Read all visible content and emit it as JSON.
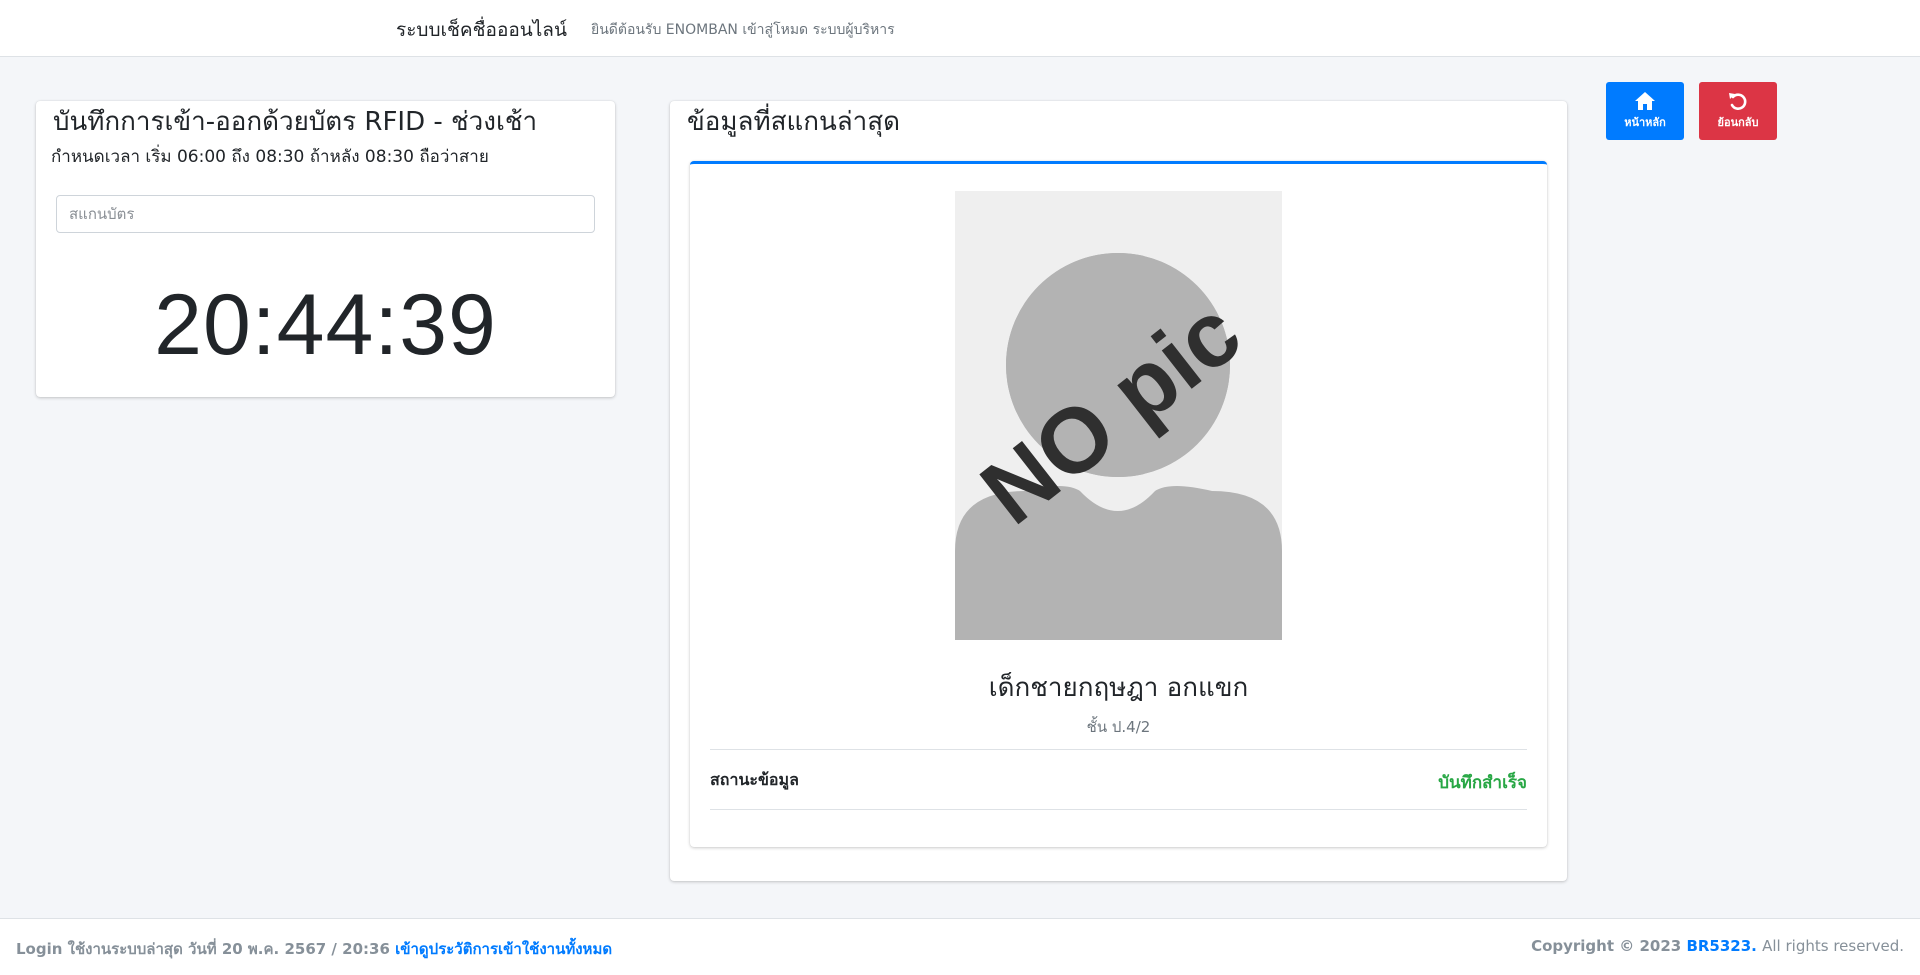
{
  "navbar": {
    "brand": "ระบบเช็คชื่อออนไลน์",
    "welcome": "ยินดีต้อนรับ ENOMBAN เข้าสู่โหมด ระบบผู้บริหาร"
  },
  "scan_panel": {
    "title": "บันทึกการเข้า-ออกด้วยบัตร RFID - ช่วงเช้า",
    "subtitle": "กำหนดเวลา เริ่ม 06:00 ถึง 08:30 ถ้าหลัง 08:30 ถือว่าสาย",
    "input_placeholder": "สแกนบัตร",
    "input_value": "",
    "clock": "20:44:39"
  },
  "latest_scan": {
    "title": "ข้อมูลที่สแกนล่าสุด",
    "photo_alt_text": "NO pic",
    "student_name": "เด็กชายกฤษฎา อกแขก",
    "student_class": "ชั้น ป.4/2",
    "status_label": "สถานะข้อมูล",
    "status_value": "บันทึกสำเร็จ",
    "status_color": "#28a745"
  },
  "actions": {
    "home_label": "หน้าหลัก",
    "home_icon": "home-icon",
    "home_color": "#007bff",
    "back_label": "ย้อนกลับ",
    "back_icon": "undo-icon",
    "back_color": "#dc3545"
  },
  "footer": {
    "login_prefix": "Login ใช้งานระบบล่าสุด วันที่ 20 พ.ค. 2567 / 20:36",
    "history_link": "เข้าดูประวัติการเข้าใช้งานทั้งหมด",
    "copyright_prefix": "Copyright © 2023",
    "brand_link": "BR5323.",
    "rights": "All rights reserved."
  }
}
